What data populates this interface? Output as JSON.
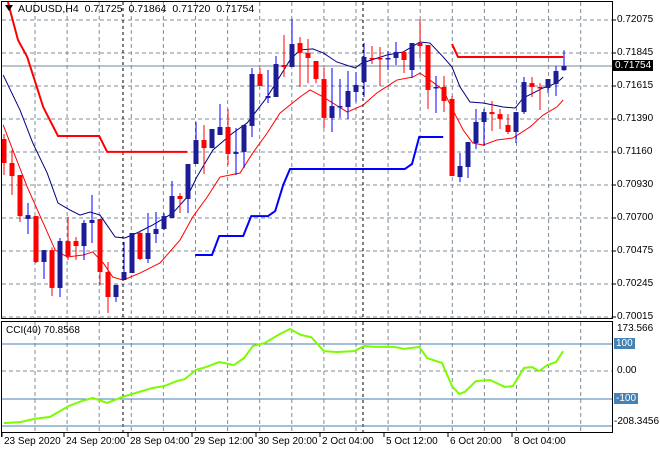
{
  "header": {
    "symbol": "AUDUSD,H4",
    "open": "0.71725",
    "high": "0.71864",
    "low": "0.71720",
    "close": "0.71754"
  },
  "price_axis": {
    "labels": [
      "0.72075",
      "0.71845",
      "0.71615",
      "0.71390",
      "0.71160",
      "0.70930",
      "0.70700",
      "0.70475",
      "0.70245",
      "0.70015"
    ],
    "current_price": "0.71754"
  },
  "cci_panel": {
    "label": "CCI(40) 70.8568",
    "max_label": "173.566",
    "level_high": "100",
    "zero": "0.00",
    "level_low": "-100",
    "min_label": "-208.3456"
  },
  "time_axis": {
    "labels": [
      "23 Sep 2020",
      "24 Sep 20:00",
      "28 Sep 04:00",
      "29 Sep 12:00",
      "30 Sep 20:00",
      "2 Oct 04:00",
      "5 Oct 12:00",
      "6 Oct 20:00",
      "8 Oct 04:00"
    ]
  },
  "colors": {
    "bull": "#1c1c96",
    "bull_wick": "#0000ff",
    "bear": "#ff0000",
    "ma_fast": "#000080",
    "ma_slow": "#ff0000",
    "resistance": "#ff0000",
    "support": "#0000ff",
    "cci": "#7cfc00",
    "levels": "#4682b4",
    "grid": "#7f8c99"
  },
  "chart_data": {
    "type": "candlestick",
    "title": "AUDUSD,H4",
    "ylim": [
      0.70015,
      0.72214
    ],
    "candles_ohlc": [
      [
        0.71245,
        0.7128,
        0.70994,
        0.71078
      ],
      [
        0.71078,
        0.71168,
        0.70855,
        0.70987
      ],
      [
        0.70994,
        0.70994,
        0.70667,
        0.70708
      ],
      [
        0.70688,
        0.70799,
        0.70583,
        0.70715
      ],
      [
        0.70708,
        0.70708,
        0.70381,
        0.70388
      ],
      [
        0.70388,
        0.70471,
        0.70269,
        0.70471
      ],
      [
        0.70471,
        0.7049,
        0.70151,
        0.70207
      ],
      [
        0.70207,
        0.70555,
        0.70144,
        0.70534
      ],
      [
        0.70534,
        0.70702,
        0.70402,
        0.7043
      ],
      [
        0.70534,
        0.70562,
        0.70402,
        0.70499
      ],
      [
        0.70499,
        0.70681,
        0.70402,
        0.7066
      ],
      [
        0.7066,
        0.70855,
        0.7052,
        0.70681
      ],
      [
        0.70688,
        0.70688,
        0.70228,
        0.70318
      ],
      [
        0.70318,
        0.70388,
        0.70032,
        0.70144
      ],
      [
        0.70144,
        0.70228,
        0.7011,
        0.70228
      ],
      [
        0.70262,
        0.70527,
        0.70262,
        0.70318
      ],
      [
        0.70311,
        0.7059,
        0.70311,
        0.7059
      ],
      [
        0.7059,
        0.70604,
        0.70402,
        0.70409
      ],
      [
        0.70409,
        0.70729,
        0.70381,
        0.7059
      ],
      [
        0.70583,
        0.70736,
        0.7052,
        0.70618
      ],
      [
        0.70618,
        0.70729,
        0.70611,
        0.70708
      ],
      [
        0.70695,
        0.70952,
        0.70695,
        0.70848
      ],
      [
        0.70848,
        0.70869,
        0.70729,
        0.70827
      ],
      [
        0.70827,
        0.71071,
        0.70729,
        0.71071
      ],
      [
        0.71071,
        0.71364,
        0.71071,
        0.71238
      ],
      [
        0.71238,
        0.71343,
        0.71001,
        0.71182
      ],
      [
        0.71182,
        0.71315,
        0.71182,
        0.71315
      ],
      [
        0.71273,
        0.71489,
        0.71273,
        0.71329
      ],
      [
        0.71329,
        0.71454,
        0.71064,
        0.71141
      ],
      [
        0.71141,
        0.71322,
        0.70994,
        0.71155
      ],
      [
        0.71155,
        0.71343,
        0.71043,
        0.71343
      ],
      [
        0.71336,
        0.7174,
        0.71259,
        0.71698
      ],
      [
        0.71698,
        0.7174,
        0.71615,
        0.71615
      ],
      [
        0.71531,
        0.71726,
        0.71496,
        0.71545
      ],
      [
        0.71538,
        0.71824,
        0.71538,
        0.71768
      ],
      [
        0.71761,
        0.7197,
        0.71677,
        0.71747
      ],
      [
        0.71747,
        0.72082,
        0.71747,
        0.71907
      ],
      [
        0.71914,
        0.71956,
        0.71608,
        0.71845
      ],
      [
        0.71845,
        0.71942,
        0.71635,
        0.7181
      ],
      [
        0.71789,
        0.71789,
        0.71635,
        0.71663
      ],
      [
        0.71663,
        0.7174,
        0.71322,
        0.71392
      ],
      [
        0.71392,
        0.7174,
        0.71294,
        0.71475
      ],
      [
        0.71468,
        0.71663,
        0.71392,
        0.71475
      ],
      [
        0.71468,
        0.71719,
        0.71385,
        0.7158
      ],
      [
        0.71573,
        0.71712,
        0.71503,
        0.71622
      ],
      [
        0.71642,
        0.71914,
        0.71538,
        0.71817
      ],
      [
        0.7181,
        0.71893,
        0.71768,
        0.71803
      ],
      [
        0.7181,
        0.71886,
        0.71615,
        0.71803
      ],
      [
        0.71803,
        0.71859,
        0.71726,
        0.7181
      ],
      [
        0.7181,
        0.71921,
        0.71761,
        0.71852
      ],
      [
        0.71852,
        0.71852,
        0.71705,
        0.71796
      ],
      [
        0.71726,
        0.71914,
        0.7167,
        0.71914
      ],
      [
        0.71914,
        0.72082,
        0.7181,
        0.71893
      ],
      [
        0.719,
        0.719,
        0.71454,
        0.71587
      ],
      [
        0.71601,
        0.71684,
        0.71426,
        0.71608
      ],
      [
        0.71608,
        0.71684,
        0.71433,
        0.7151
      ],
      [
        0.71524,
        0.71545,
        0.70987,
        0.70987
      ],
      [
        0.7098,
        0.71148,
        0.70945,
        0.71057
      ],
      [
        0.7105,
        0.71224,
        0.70973,
        0.71224
      ],
      [
        0.71217,
        0.71454,
        0.71175,
        0.71364
      ],
      [
        0.71364,
        0.71454,
        0.71196,
        0.71433
      ],
      [
        0.71433,
        0.7151,
        0.71301,
        0.71419
      ],
      [
        0.71419,
        0.71454,
        0.71315,
        0.71385
      ],
      [
        0.71343,
        0.71419,
        0.7128,
        0.71294
      ],
      [
        0.71294,
        0.71433,
        0.71217,
        0.71433
      ],
      [
        0.71433,
        0.71677,
        0.71419,
        0.71642
      ],
      [
        0.71635,
        0.71677,
        0.71538,
        0.71608
      ],
      [
        0.71608,
        0.71635,
        0.71447,
        0.71601
      ],
      [
        0.71601,
        0.71663,
        0.71566,
        0.71663
      ],
      [
        0.71629,
        0.71754,
        0.71545,
        0.71719
      ],
      [
        0.71725,
        0.71864,
        0.7172,
        0.71754
      ]
    ],
    "ma_fast": [
      [
        -0.1,
        0.71691
      ],
      [
        2,
        0.71447
      ],
      [
        3.6,
        0.71217
      ],
      [
        5.4,
        0.71008
      ],
      [
        6.75,
        0.70799
      ],
      [
        8.25,
        0.7075
      ],
      [
        9.5,
        0.70715
      ],
      [
        10.75,
        0.70736
      ],
      [
        12,
        0.70715
      ],
      [
        13.9,
        0.70562
      ],
      [
        15.1,
        0.70555
      ],
      [
        16.6,
        0.7059
      ],
      [
        18.6,
        0.70646
      ],
      [
        21.1,
        0.70729
      ],
      [
        22.9,
        0.70841
      ],
      [
        24.1,
        0.7098
      ],
      [
        26.1,
        0.71168
      ],
      [
        28.6,
        0.71287
      ],
      [
        30.4,
        0.71357
      ],
      [
        32.9,
        0.71538
      ],
      [
        35.75,
        0.71796
      ],
      [
        37,
        0.71866
      ],
      [
        38.6,
        0.71873
      ],
      [
        39.9,
        0.71845
      ],
      [
        41.6,
        0.71782
      ],
      [
        43.9,
        0.7174
      ],
      [
        44.75,
        0.71775
      ],
      [
        47.9,
        0.71831
      ],
      [
        49.9,
        0.71852
      ],
      [
        52,
        0.71921
      ],
      [
        53.25,
        0.71914
      ],
      [
        54.9,
        0.71817
      ],
      [
        56,
        0.71747
      ],
      [
        57,
        0.71608
      ],
      [
        58.25,
        0.71503
      ],
      [
        59.9,
        0.71496
      ],
      [
        62.4,
        0.71468
      ],
      [
        63.9,
        0.71461
      ],
      [
        64.9,
        0.71531
      ],
      [
        67.4,
        0.71601
      ],
      [
        69.1,
        0.71636
      ],
      [
        69.9,
        0.71677
      ]
    ],
    "ma_slow": [
      [
        -0.1,
        0.71343
      ],
      [
        1.1,
        0.71168
      ],
      [
        2.9,
        0.70911
      ],
      [
        4.9,
        0.7066
      ],
      [
        6.4,
        0.70471
      ],
      [
        7.9,
        0.70423
      ],
      [
        9.9,
        0.70437
      ],
      [
        11.1,
        0.70458
      ],
      [
        12.4,
        0.70381
      ],
      [
        13.6,
        0.70283
      ],
      [
        14.9,
        0.70262
      ],
      [
        17,
        0.70311
      ],
      [
        19.5,
        0.70381
      ],
      [
        22,
        0.70541
      ],
      [
        23.6,
        0.70702
      ],
      [
        25.4,
        0.70841
      ],
      [
        27,
        0.7098
      ],
      [
        29.5,
        0.71008
      ],
      [
        31.1,
        0.71148
      ],
      [
        32.9,
        0.71287
      ],
      [
        34.5,
        0.71426
      ],
      [
        37,
        0.71538
      ],
      [
        38.25,
        0.71587
      ],
      [
        39.9,
        0.71538
      ],
      [
        42.9,
        0.71433
      ],
      [
        44.9,
        0.71482
      ],
      [
        46.6,
        0.71566
      ],
      [
        49.1,
        0.71656
      ],
      [
        51.1,
        0.71677
      ],
      [
        52,
        0.71705
      ],
      [
        53.25,
        0.71656
      ],
      [
        54.9,
        0.71587
      ],
      [
        56.1,
        0.71447
      ],
      [
        57.4,
        0.71308
      ],
      [
        58.6,
        0.71217
      ],
      [
        59.9,
        0.71203
      ],
      [
        61.6,
        0.71238
      ],
      [
        63.6,
        0.71252
      ],
      [
        65.75,
        0.71329
      ],
      [
        67.4,
        0.71412
      ],
      [
        69.1,
        0.71468
      ],
      [
        69.9,
        0.71517
      ]
    ],
    "resistance": [
      [
        [
          0.5,
          0.722
        ],
        [
          0.75,
          0.72144
        ],
        [
          1.75,
          0.71935
        ],
        [
          2.9,
          0.71817
        ],
        [
          4.1,
          0.71608
        ],
        [
          4.9,
          0.71468
        ],
        [
          6.75,
          0.71266
        ],
        [
          11.9,
          0.71266
        ],
        [
          12.9,
          0.71155
        ],
        [
          22.9,
          0.71155
        ]
      ],
      [
        [
          56,
          0.71907
        ],
        [
          56.75,
          0.71817
        ],
        [
          69.9,
          0.71817
        ]
      ]
    ],
    "support": [
      [
        23.9,
        0.70437
      ],
      [
        26,
        0.70437
      ],
      [
        26.9,
        0.70569
      ],
      [
        29.9,
        0.70569
      ],
      [
        30.9,
        0.70708
      ],
      [
        33,
        0.70708
      ],
      [
        33.9,
        0.70743
      ],
      [
        34.9,
        0.70925
      ],
      [
        35.75,
        0.71036
      ],
      [
        50.1,
        0.71036
      ],
      [
        51,
        0.71071
      ],
      [
        51.9,
        0.71259
      ],
      [
        54.9,
        0.71259
      ]
    ],
    "cci": {
      "period": 40,
      "ylim": [
        -208.3456,
        173.566
      ],
      "levels": [
        100,
        -100
      ],
      "points": [
        [
          0,
          -186
        ],
        [
          2.1,
          -182
        ],
        [
          3.75,
          -171
        ],
        [
          5.75,
          -164
        ],
        [
          8.1,
          -125
        ],
        [
          9.75,
          -107
        ],
        [
          11.1,
          -96
        ],
        [
          12.9,
          -114
        ],
        [
          14.75,
          -93
        ],
        [
          16.4,
          -79
        ],
        [
          18.5,
          -61
        ],
        [
          20,
          -54
        ],
        [
          21.6,
          -36
        ],
        [
          22.6,
          -29
        ],
        [
          24,
          4
        ],
        [
          25.25,
          14
        ],
        [
          26.9,
          32
        ],
        [
          28.75,
          21
        ],
        [
          30,
          46
        ],
        [
          31.1,
          89
        ],
        [
          32.6,
          100
        ],
        [
          34.5,
          132
        ],
        [
          35.75,
          150
        ],
        [
          37.1,
          129
        ],
        [
          38.4,
          121
        ],
        [
          40,
          71
        ],
        [
          41.6,
          68
        ],
        [
          43.75,
          71
        ],
        [
          45,
          89
        ],
        [
          46.4,
          86
        ],
        [
          48.75,
          86
        ],
        [
          50,
          79
        ],
        [
          51.9,
          86
        ],
        [
          52.9,
          46
        ],
        [
          54.75,
          29
        ],
        [
          56,
          -54
        ],
        [
          56.9,
          -82
        ],
        [
          57.6,
          -75
        ],
        [
          59,
          -36
        ],
        [
          60.75,
          -32
        ],
        [
          62.6,
          -57
        ],
        [
          63.6,
          -54
        ],
        [
          65,
          11
        ],
        [
          66,
          14
        ],
        [
          66.9,
          0
        ],
        [
          67.9,
          21
        ],
        [
          69,
          32
        ],
        [
          69.9,
          70.86
        ]
      ]
    }
  }
}
